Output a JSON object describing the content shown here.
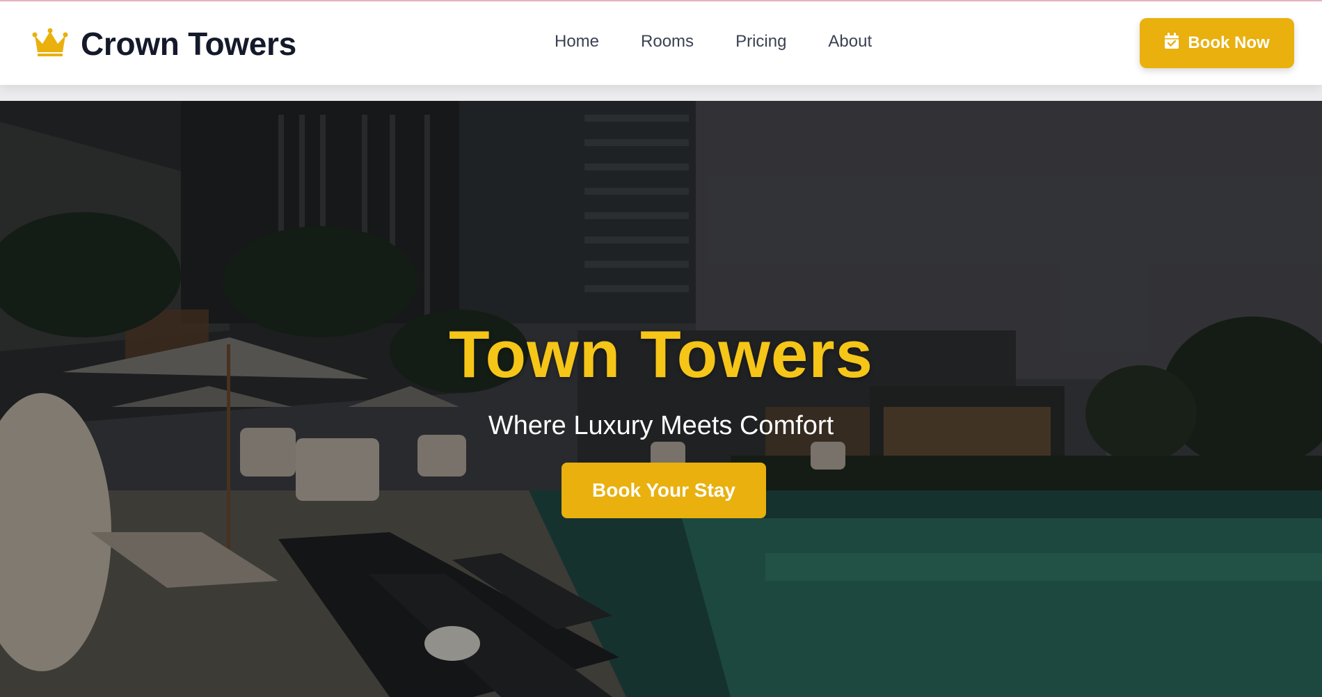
{
  "header": {
    "brand_name": "Crown Towers",
    "brand_icon": "crown-icon",
    "nav": [
      {
        "label": "Home"
      },
      {
        "label": "Rooms"
      },
      {
        "label": "Pricing"
      },
      {
        "label": "About"
      }
    ],
    "book_now_label": "Book Now",
    "book_now_icon": "calendar-check-icon"
  },
  "hero": {
    "title": "Town Towers",
    "subtitle": "Where Luxury Meets Comfort",
    "cta_label": "Book Your Stay",
    "background": "hotel pool terrace at dusk"
  },
  "colors": {
    "accent": "#e9b00e",
    "title_gold": "#f5c518",
    "brand_text": "#141a2a",
    "nav_text": "#3a4252"
  }
}
